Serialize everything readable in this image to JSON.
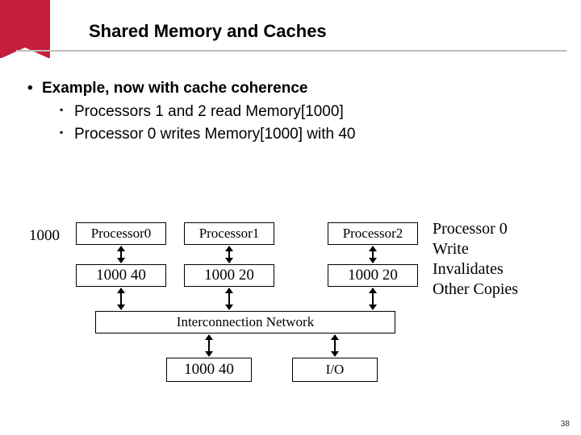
{
  "title": "Shared Memory and Caches",
  "bullets": {
    "l1": "Example, now with cache coherence",
    "l2a": "Processors 1 and 2 read Memory[1000]",
    "l2b": "Processor 0 writes Memory[1000] with 40"
  },
  "diagram": {
    "mem_label": "1000",
    "proc0": "Processor0",
    "proc1": "Processor1",
    "proc2": "Processor2",
    "cache0": "1000 40",
    "cache1": "1000 20",
    "cache2": "1000 20",
    "bus": "Interconnection Network",
    "memory": "1000 40",
    "io": "I/O",
    "annotation_l1": "Processor 0",
    "annotation_l2": "Write",
    "annotation_l3": "Invalidates",
    "annotation_l4": "Other Copies"
  },
  "pagenum": "38"
}
